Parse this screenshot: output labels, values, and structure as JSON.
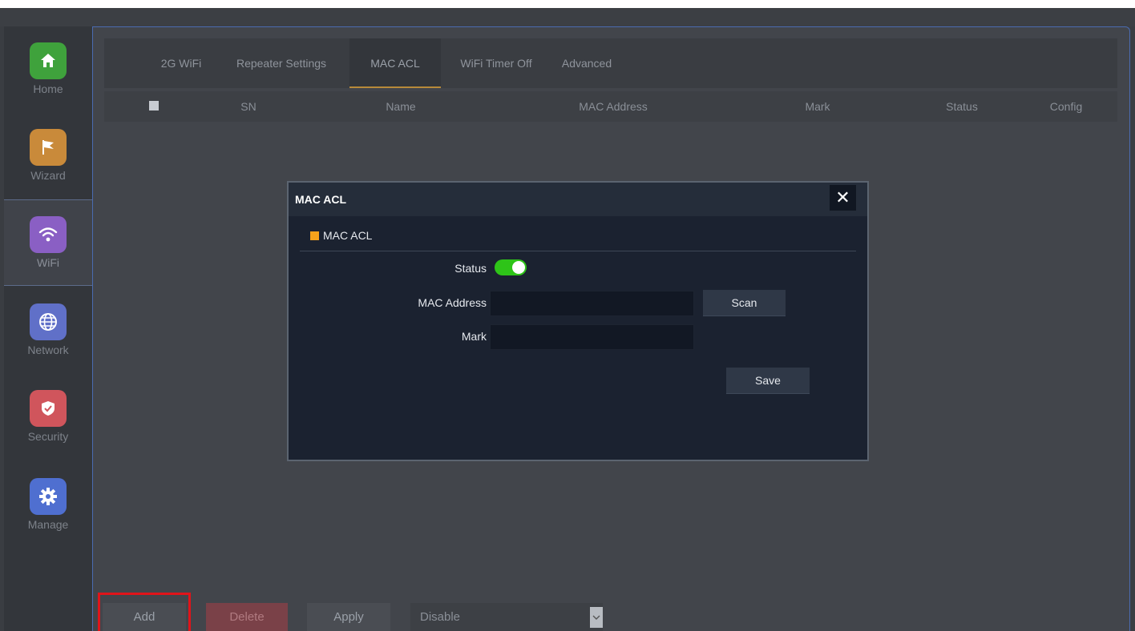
{
  "sidebar": {
    "items": [
      {
        "label": "Home",
        "icon": "home-icon",
        "color": "#3fa23c"
      },
      {
        "label": "Wizard",
        "icon": "flag-icon",
        "color": "#c98a3a"
      },
      {
        "label": "WiFi",
        "icon": "wifi-icon",
        "color": "#8a5fc4"
      },
      {
        "label": "Network",
        "icon": "globe-icon",
        "color": "#6070c8"
      },
      {
        "label": "Security",
        "icon": "shield-icon",
        "color": "#d0555c"
      },
      {
        "label": "Manage",
        "icon": "gear-icon",
        "color": "#4f6fd0"
      }
    ]
  },
  "tabs": [
    "2G WiFi",
    "Repeater Settings",
    "MAC ACL",
    "WiFi Timer Off",
    "Advanced"
  ],
  "active_tab": "MAC ACL",
  "table": {
    "columns": [
      "SN",
      "Name",
      "MAC Address",
      "Mark",
      "Status",
      "Config"
    ]
  },
  "toolbar": {
    "add_label": "Add",
    "delete_label": "Delete",
    "apply_label": "Apply",
    "mode_value": "Disable"
  },
  "modal": {
    "title": "MAC ACL",
    "close_glyph": "✕",
    "section_title": "MAC ACL",
    "status_label": "Status",
    "status_on": true,
    "mac_label": "MAC Address",
    "mac_value": "",
    "mark_label": "Mark",
    "mark_value": "",
    "scan_label": "Scan",
    "save_label": "Save"
  },
  "colors": {
    "accent": "#f5a21b",
    "toggle_on": "#2ec418",
    "highlight": "#e0141a"
  }
}
